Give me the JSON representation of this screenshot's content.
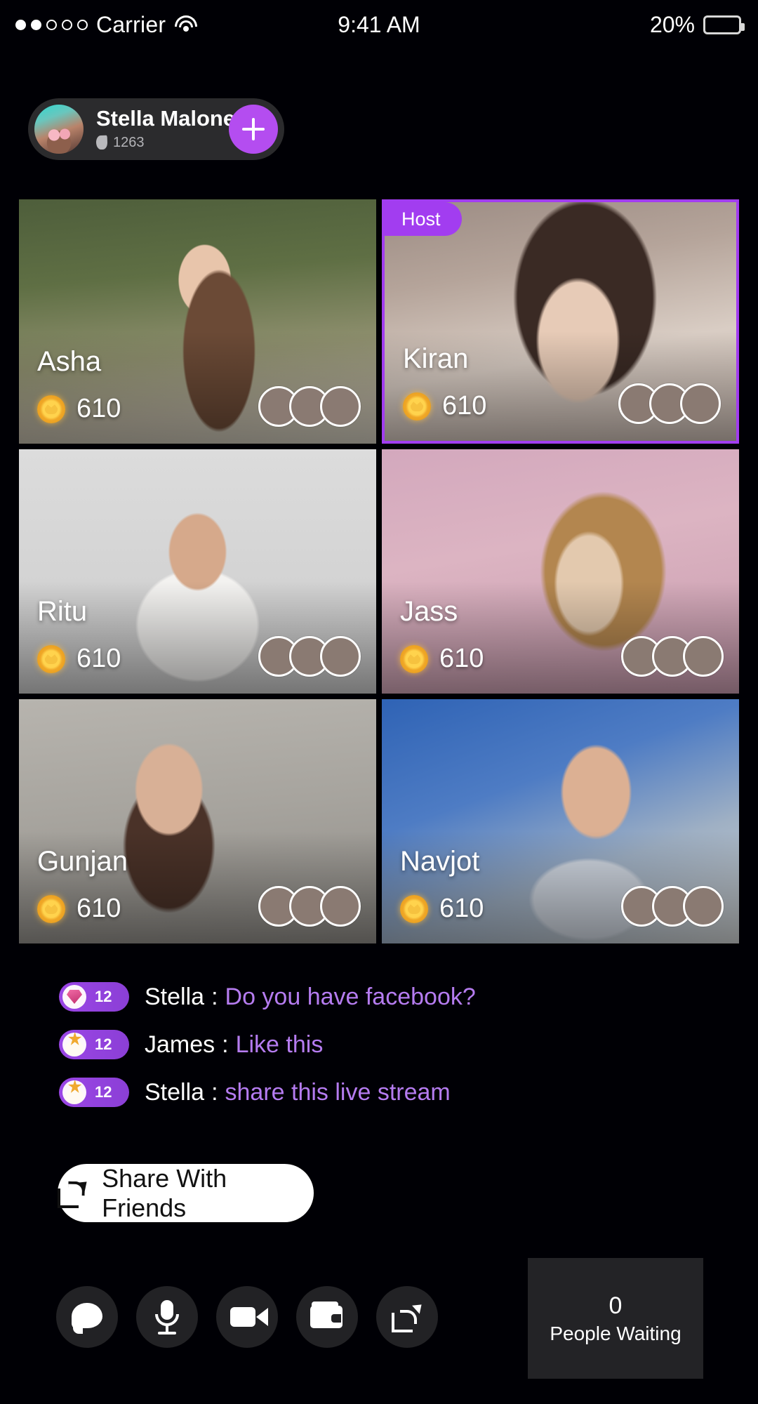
{
  "status_bar": {
    "signal_dots_filled": 2,
    "signal_dots_total": 5,
    "carrier": "Carrier",
    "wifi_icon": "wifi-icon",
    "time": "9:41 AM",
    "battery_percent": "20%",
    "battery_level": 20
  },
  "header": {
    "avatar": "user-avatar",
    "name": "Stella Malone",
    "flame_icon": "flame-icon",
    "streak_count": "1263",
    "add_button": "plus-icon"
  },
  "grid": {
    "host_badge_label": "Host",
    "accent_purple": "#a23df0",
    "coin_icon": "coin-icon",
    "tiles": [
      {
        "name": "Asha",
        "coins": "610",
        "is_host": false,
        "photo": "ph-asha"
      },
      {
        "name": "Kiran",
        "coins": "610",
        "is_host": true,
        "photo": "ph-kiran"
      },
      {
        "name": "Ritu",
        "coins": "610",
        "is_host": false,
        "photo": "ph-ritu"
      },
      {
        "name": "Jass",
        "coins": "610",
        "is_host": false,
        "photo": "ph-jass"
      },
      {
        "name": "Gunjan",
        "coins": "610",
        "is_host": false,
        "photo": "ph-gunjan"
      },
      {
        "name": "Navjot",
        "coins": "610",
        "is_host": false,
        "photo": "ph-navjot"
      }
    ]
  },
  "chat": {
    "message_color": "#b57cf0",
    "messages": [
      {
        "badge_icon": "gem-icon",
        "badge_count": "12",
        "user": "Stella",
        "separator": ":",
        "text": "Do you have facebook?"
      },
      {
        "badge_icon": "star-egg-icon",
        "badge_count": "12",
        "user": "James",
        "separator": ":",
        "text": "Like this"
      },
      {
        "badge_icon": "star-egg-icon",
        "badge_count": "12",
        "user": "Stella",
        "separator": ":",
        "text": "share this live stream"
      }
    ]
  },
  "share_button": {
    "icon": "share-icon",
    "label": "Share With Friends"
  },
  "toolbar": {
    "buttons": [
      {
        "icon": "chat-bubble-icon"
      },
      {
        "icon": "microphone-icon"
      },
      {
        "icon": "video-camera-icon"
      },
      {
        "icon": "wallet-icon"
      },
      {
        "icon": "share-icon"
      }
    ]
  },
  "waiting_panel": {
    "count": "0",
    "label": "People Waiting"
  }
}
